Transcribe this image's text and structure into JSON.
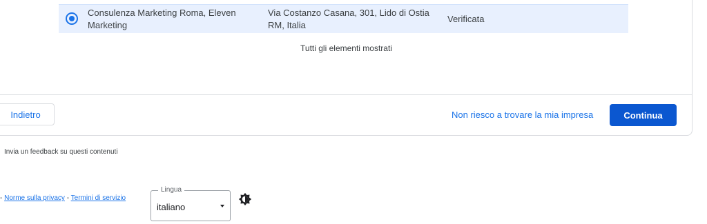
{
  "business_row": {
    "name": "Consulenza Marketing Roma, Eleven Marketing",
    "address": "Via Costanzo Casana, 301, Lido di Ostia RM, Italia",
    "status": "Verificata",
    "selected": true
  },
  "list_footer": "Tutti gli elementi mostrati",
  "actions": {
    "back_label": "Indietro",
    "not_found_link": "Non riesco a trovare la mia impresa",
    "continue_label": "Continua"
  },
  "feedback_text": "Invia un feedback su questi contenuti",
  "footer": {
    "prefix": "- ",
    "privacy_label": "Norme sulla privacy",
    "separator": " - ",
    "terms_label": "Termini di servizio"
  },
  "language": {
    "legend": "Lingua",
    "selected": "italiano"
  },
  "icons": {
    "radio": "radio-selected-icon",
    "dropdown": "caret-down-icon",
    "theme": "brightness-icon"
  },
  "colors": {
    "accent": "#1a73e8",
    "primary_button": "#0b57d0",
    "selected_row": "#e8f0fe"
  }
}
